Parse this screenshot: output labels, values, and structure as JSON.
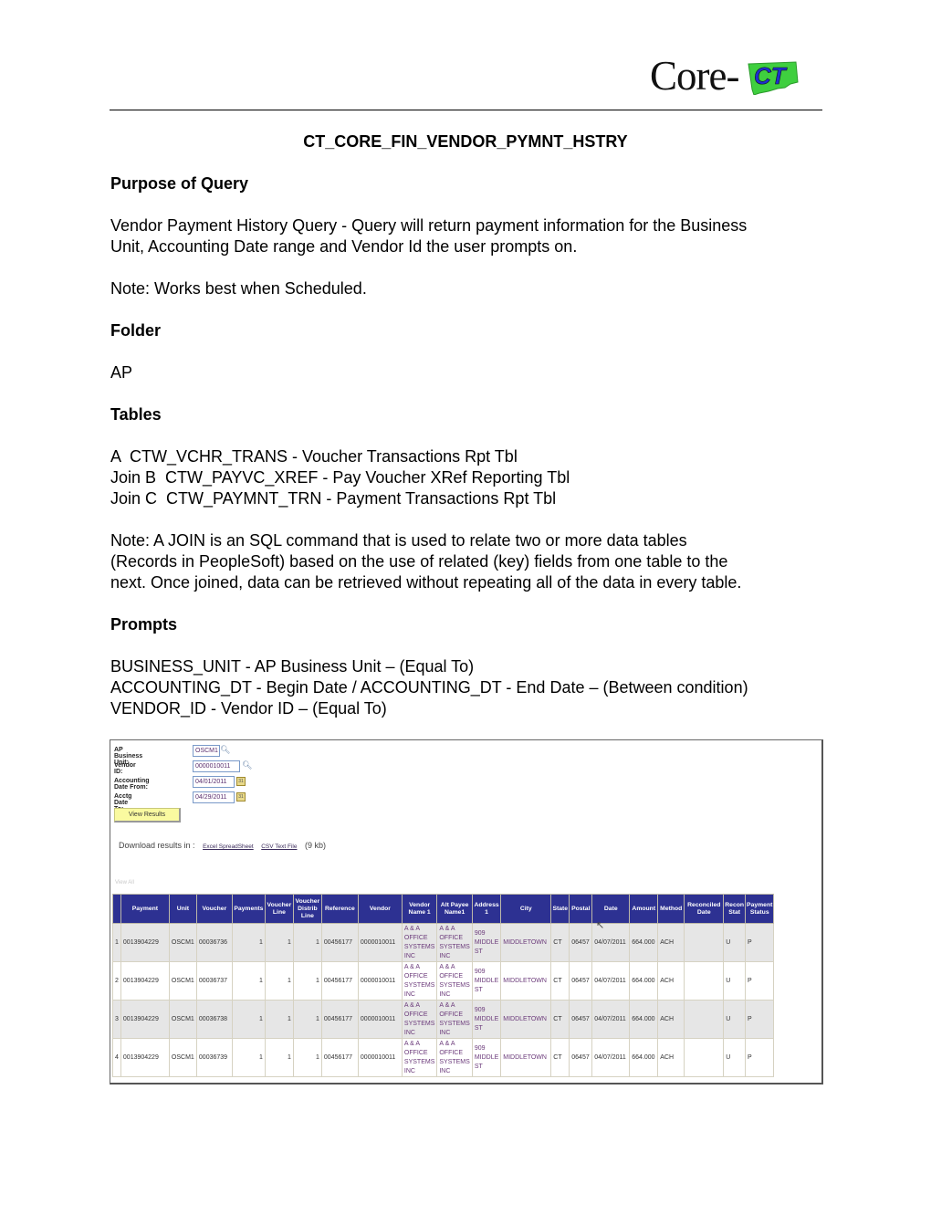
{
  "logo": {
    "text": "Core-",
    "badge": "CT"
  },
  "document": {
    "title": "CT_CORE_FIN_VENDOR_PYMNT_HSTRY",
    "purpose_heading": "Purpose of Query",
    "purpose_text": "Vendor Payment History Query - Query will return payment information for the Business\nUnit, Accounting Date range and Vendor Id the user prompts on.",
    "note_scheduled": "Note: Works best when Scheduled.",
    "folder_heading": "Folder",
    "folder_value": "AP",
    "tables_heading": "Tables",
    "tables": [
      "A  CTW_VCHR_TRANS - Voucher Transactions Rpt Tbl",
      "Join B  CTW_PAYVC_XREF - Pay Voucher XRef Reporting Tbl",
      "Join C  CTW_PAYMNT_TRN - Payment Transactions Rpt Tbl"
    ],
    "join_note": "Note: A JOIN is an SQL command that is used to relate two or more data tables\n(Records in PeopleSoft) based on the use of related (key) fields from one table to the\nnext. Once joined, data can be retrieved without repeating all of the data in every table.",
    "prompts_heading": "Prompts",
    "prompts": [
      "BUSINESS_UNIT - AP Business Unit – (Equal To)",
      "ACCOUNTING_DT - Begin Date / ACCOUNTING_DT - End Date – (Between condition)",
      "VENDOR_ID - Vendor ID – (Equal To)"
    ]
  },
  "screenshot": {
    "form": {
      "business_unit_label": "AP Business Unit:",
      "business_unit_value": "OSCM1",
      "vendor_id_label": "Vendor ID:",
      "vendor_id_value": "0000010011",
      "date_from_label": "Accounting Date From:",
      "date_from_value": "04/01/2011",
      "date_to_label": "Acctg Date To:",
      "date_to_value": "04/29/2011",
      "view_results_label": "View Results"
    },
    "download": {
      "label": "Download results in :",
      "excel_link": "Excel SpreadSheet",
      "csv_link": "CSV Text File",
      "size": "(9 kb)"
    },
    "view_all": "View All",
    "icons": {
      "lookup": "search-icon",
      "calendar": "calendar-icon"
    },
    "columns": [
      "",
      "Payment",
      "Unit",
      "Voucher",
      "Payments",
      "Voucher Line",
      "Voucher Distrib Line",
      "Reference",
      "Vendor",
      "Vendor Name 1",
      "Alt Payee Name1",
      "Address 1",
      "City",
      "State",
      "Postal",
      "Date",
      "Amount",
      "Method",
      "Reconciled Date",
      "Recon Stat",
      "Payment Status"
    ],
    "rows": [
      [
        "1",
        "0013904229",
        "OSCM1",
        "00036736",
        "1",
        "1",
        "1",
        "00456177",
        "0000010011",
        "A & A OFFICE SYSTEMS INC",
        "A & A OFFICE SYSTEMS INC",
        "909 MIDDLE ST",
        "MIDDLETOWN",
        "CT",
        "06457",
        "04/07/2011",
        "664.000",
        "ACH",
        "",
        "U",
        "P"
      ],
      [
        "2",
        "0013904229",
        "OSCM1",
        "00036737",
        "1",
        "1",
        "1",
        "00456177",
        "0000010011",
        "A & A OFFICE SYSTEMS INC",
        "A & A OFFICE SYSTEMS INC",
        "909 MIDDLE ST",
        "MIDDLETOWN",
        "CT",
        "06457",
        "04/07/2011",
        "664.000",
        "ACH",
        "",
        "U",
        "P"
      ],
      [
        "3",
        "0013904229",
        "OSCM1",
        "00036738",
        "1",
        "1",
        "1",
        "00456177",
        "0000010011",
        "A & A OFFICE SYSTEMS INC",
        "A & A OFFICE SYSTEMS INC",
        "909 MIDDLE ST",
        "MIDDLETOWN",
        "CT",
        "06457",
        "04/07/2011",
        "664.000",
        "ACH",
        "",
        "U",
        "P"
      ],
      [
        "4",
        "0013904229",
        "OSCM1",
        "00036739",
        "1",
        "1",
        "1",
        "00456177",
        "0000010011",
        "A & A OFFICE SYSTEMS INC",
        "A & A OFFICE SYSTEMS INC",
        "909 MIDDLE ST",
        "MIDDLETOWN",
        "CT",
        "06457",
        "04/07/2011",
        "664.000",
        "ACH",
        "",
        "U",
        "P"
      ]
    ],
    "colors": {
      "header_bg": "#2d3192",
      "odd_row": "#e6e6e6",
      "button_bg": "#fafaa0",
      "link_text": "#6b3a7a"
    }
  }
}
